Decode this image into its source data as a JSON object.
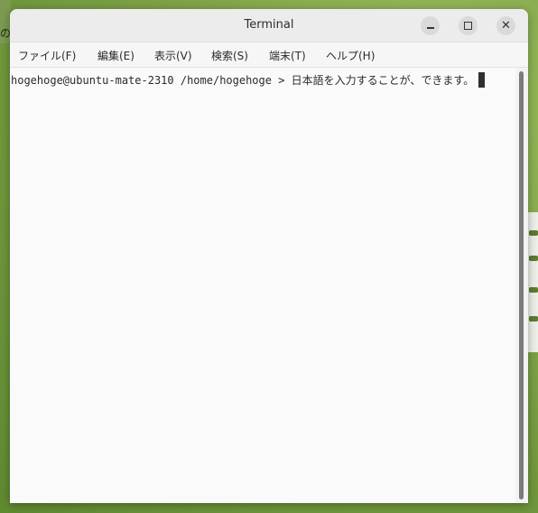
{
  "desktop": {
    "left_text": "の"
  },
  "window": {
    "title": "Terminal",
    "controls": {
      "minimize_icon": "minimize-icon",
      "maximize_icon": "maximize-icon",
      "close_icon": "close-icon",
      "close_glyph": "✕"
    }
  },
  "menu": {
    "items": [
      {
        "label": "ファイル(F)"
      },
      {
        "label": "編集(E)"
      },
      {
        "label": "表示(V)"
      },
      {
        "label": "検索(S)"
      },
      {
        "label": "端末(T)"
      },
      {
        "label": "ヘルプ(H)"
      }
    ]
  },
  "terminal": {
    "prompt": "hogehoge@ubuntu-mate-2310 /home/hogehoge > ",
    "input": "日本語を入力することが、できます。"
  },
  "colors": {
    "desktop_green": "#7ea247",
    "terminal_bg": "#fafafa",
    "titlebar_bg": "#ececec"
  }
}
